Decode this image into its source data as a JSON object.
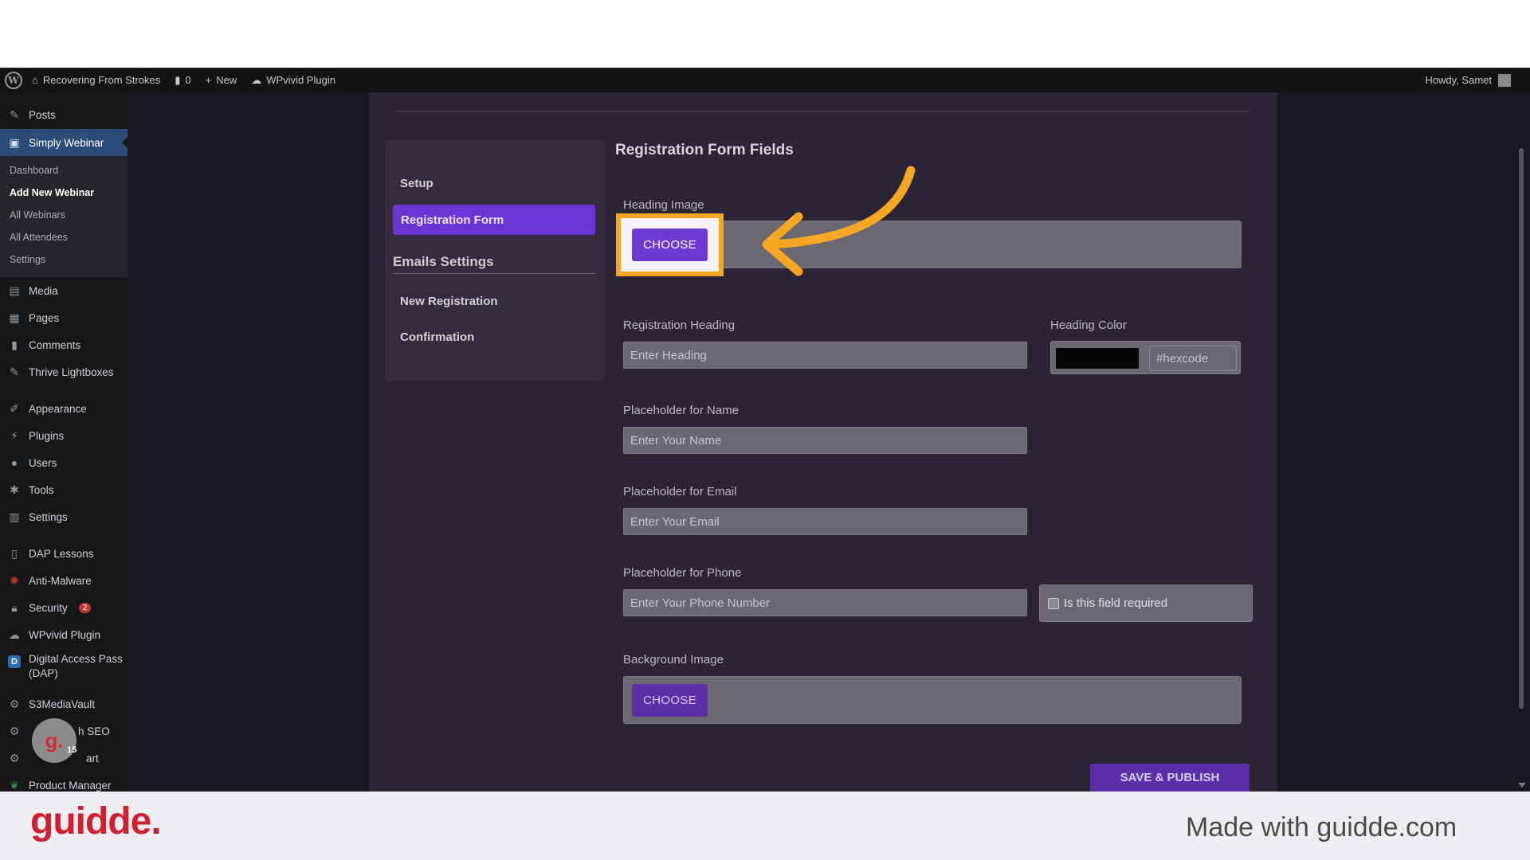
{
  "adminbar": {
    "site_name": "Recovering From Strokes",
    "comments_count": "0",
    "new_label": "New",
    "plugin_label": "WPvivid Plugin",
    "howdy": "Howdy, Samet"
  },
  "sidebar": {
    "posts": "Posts",
    "simply_webinar": "Simply Webinar",
    "sub": {
      "dashboard": "Dashboard",
      "add_new": "Add New Webinar",
      "all_webinars": "All Webinars",
      "all_attendees": "All Attendees",
      "settings": "Settings"
    },
    "media": "Media",
    "pages": "Pages",
    "comments": "Comments",
    "thrive": "Thrive Lightboxes",
    "appearance": "Appearance",
    "plugins": "Plugins",
    "users": "Users",
    "tools": "Tools",
    "settings": "Settings",
    "dap_lessons": "DAP Lessons",
    "anti_malware": "Anti-Malware",
    "security": "Security",
    "security_badge": "2",
    "wpvivid": "WPvivid Plugin",
    "dap_line1": "Digital Access Pass",
    "dap_line2": "(DAP)",
    "s3": "S3MediaVault",
    "seo": "h SEO",
    "cart": "art",
    "product_manager": "Product Manager"
  },
  "settings_nav": {
    "setup": "Setup",
    "registration_form": "Registration Form",
    "emails_heading": "Emails Settings",
    "new_registration": "New Registration",
    "confirmation": "Confirmation"
  },
  "form": {
    "title": "Registration Form Fields",
    "heading_image_label": "Heading Image",
    "choose_label": "CHOOSE",
    "registration_heading_label": "Registration Heading",
    "registration_heading_placeholder": "Enter Heading",
    "heading_color_label": "Heading Color",
    "heading_color_swatch": "#050505",
    "hex_placeholder": "#hexcode",
    "name_label": "Placeholder for Name",
    "name_placeholder": "Enter Your Name",
    "email_label": "Placeholder for Email",
    "email_placeholder": "Enter Your Email",
    "phone_label": "Placeholder for Phone",
    "phone_placeholder": "Enter Your Phone Number",
    "required_label": "Is this field required",
    "background_image_label": "Background Image",
    "background_choose_label": "CHOOSE",
    "save_label": "SAVE & PUBLISH"
  },
  "guidde": {
    "bubble_letter": "g.",
    "count": "15",
    "logo": "guidde.",
    "made_with": "Made with guidde.com"
  },
  "colors": {
    "accent": "#6b35d4",
    "highlight": "#f5a623",
    "brand_red": "#d01f2f"
  }
}
